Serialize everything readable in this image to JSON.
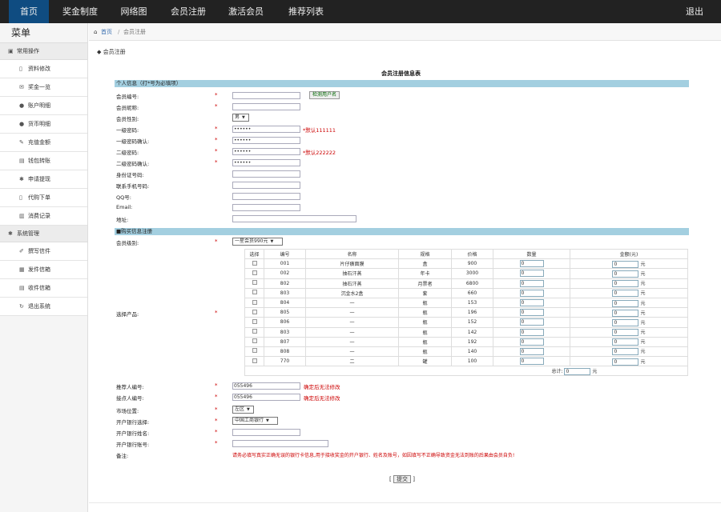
{
  "topnav": {
    "items": [
      "首页",
      "奖金制度",
      "网络图",
      "会员注册",
      "激活会员",
      "推荐列表"
    ],
    "logout": "退出",
    "active_color": "#0f4c81"
  },
  "sidebar": {
    "title": "菜单",
    "group1": "常用操作",
    "items1": [
      "资料修改",
      "奖金一览",
      "账户明细",
      "货币明细",
      "充值金额",
      "钱包转账",
      "申请提现",
      "代购下单",
      "消费记录"
    ],
    "group2": "系统管理",
    "items2": [
      "撰写信件",
      "发件信箱",
      "收件信箱",
      "退出系统"
    ]
  },
  "breadcrumb": {
    "home": "首页",
    "sep": "/",
    "current": "会员注册"
  },
  "page": {
    "heading": "会员注册"
  },
  "form": {
    "title": "会员注册信息表",
    "section1": "个人信息（打*号为必填项）",
    "fields": {
      "member_id": {
        "label": "会员编号:",
        "value": ""
      },
      "check_btn": "检测用户名",
      "nickname": {
        "label": "会员昵称:",
        "value": ""
      },
      "gender": {
        "label": "会员性别:",
        "value": "男"
      },
      "pwd1": {
        "label": "一级密码:",
        "value": "••••••",
        "note": "*默认111111"
      },
      "pwd1c": {
        "label": "一级密码确认:",
        "value": "••••••"
      },
      "pwd2": {
        "label": "二级密码:",
        "value": "••••••",
        "note": "*默认222222"
      },
      "pwd2c": {
        "label": "二级密码确认:",
        "value": "••••••"
      },
      "idcard": {
        "label": "身份证号码:",
        "value": ""
      },
      "phone": {
        "label": "联系手机号码:",
        "value": ""
      },
      "qq": {
        "label": "QQ号:",
        "value": ""
      },
      "email": {
        "label": "Email:",
        "value": ""
      },
      "address": {
        "label": "地址:",
        "value": ""
      }
    },
    "section2": "■购买信息注册",
    "level": {
      "label": "会员级别:",
      "value": "一星会员990元"
    },
    "products_label": "选择产品:",
    "table": {
      "headers": [
        "选择",
        "编号",
        "名称",
        "规格",
        "价格",
        "数量",
        "金额(元)"
      ],
      "rows": [
        [
          "001",
          "片仔癀面膜",
          "盒",
          "900",
          "0",
          "0"
        ],
        [
          "002",
          "抽石汗蒸",
          "年卡",
          "3000",
          "0",
          "0"
        ],
        [
          "802",
          "抽石汗蒸",
          "月票者",
          "6800",
          "0",
          "0"
        ],
        [
          "803",
          "沉金水2盒",
          "套",
          "660",
          "0",
          "0"
        ],
        [
          "804",
          "一",
          "瓶",
          "153",
          "0",
          "0"
        ],
        [
          "805",
          "一",
          "瓶",
          "196",
          "0",
          "0"
        ],
        [
          "806",
          "一",
          "瓶",
          "152",
          "0",
          "0"
        ],
        [
          "803",
          "一",
          "瓶",
          "142",
          "0",
          "0"
        ],
        [
          "807",
          "一",
          "瓶",
          "192",
          "0",
          "0"
        ],
        [
          "808",
          "一",
          "瓶",
          "140",
          "0",
          "0"
        ],
        [
          "770",
          "二",
          "罐",
          "100",
          "0",
          "0"
        ]
      ],
      "unit": "元",
      "total_label": "总计:",
      "total_value": "0",
      "total_unit": "元"
    },
    "referrer": {
      "label": "推荐人编号:",
      "value": "055496",
      "note": "确定后无法修改"
    },
    "placer": {
      "label": "接点人编号:",
      "value": "055496",
      "note": "确定后无法修改"
    },
    "market": {
      "label": "市场位置:",
      "value": "左区"
    },
    "bank": {
      "label": "开户银行选择:",
      "value": "中国工商银行"
    },
    "bank_name": {
      "label": "开户银行姓名:",
      "value": ""
    },
    "bank_acct": {
      "label": "开户银行账号:",
      "value": ""
    },
    "remark": {
      "label": "备注:",
      "note": "请务必填写真实正确无误的银行卡信息,用于接收奖金的开户银行、姓名及账号，如因填写不正确导致资金无法到账的后果由会员自负!"
    },
    "submit": "提交",
    "required_mark": "*"
  }
}
